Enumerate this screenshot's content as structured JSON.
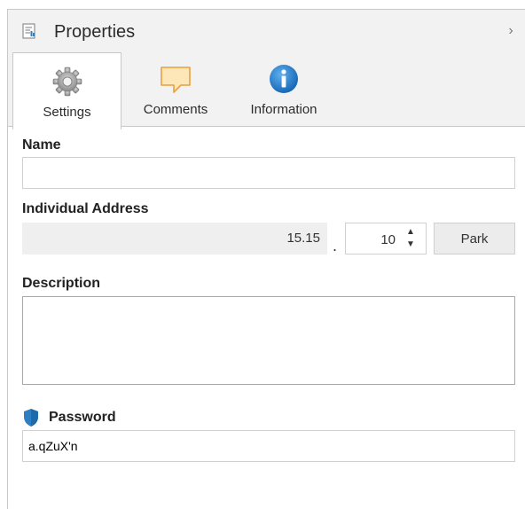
{
  "header": {
    "title": "Properties",
    "icon": "properties-doc-icon",
    "collapse_glyph": "›"
  },
  "tabs": [
    {
      "label": "Settings",
      "icon": "gear-icon",
      "selected": true
    },
    {
      "label": "Comments",
      "icon": "comment-bubble-icon",
      "selected": false
    },
    {
      "label": "Information",
      "icon": "info-icon",
      "selected": false
    }
  ],
  "fields": {
    "name": {
      "label": "Name",
      "value": ""
    },
    "individual_address": {
      "label": "Individual Address",
      "prefix": "15.15",
      "separator": ".",
      "device": "10",
      "park_label": "Park"
    },
    "description": {
      "label": "Description",
      "value": ""
    },
    "password": {
      "label": "Password",
      "value": "a.qZuX'n",
      "icon": "shield-icon"
    }
  },
  "colors": {
    "header_bg": "#f2f2f2",
    "shield_blue": "#2d7fc4",
    "info_blue": "#1f78c8",
    "comment_orange": "#e8a040"
  }
}
